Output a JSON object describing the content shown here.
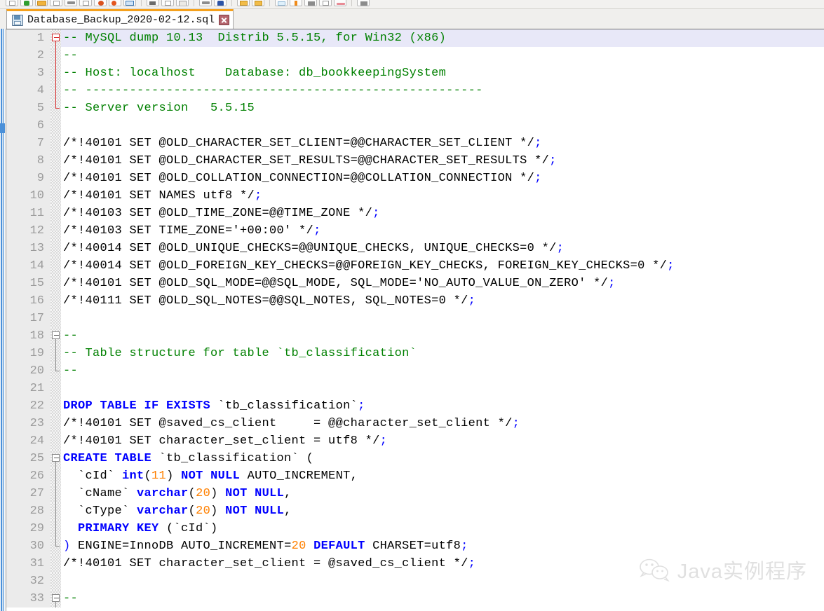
{
  "toolbar": {
    "icons": [
      "new-file-icon",
      "open-folder-icon",
      "save-icon",
      "save-all-icon",
      "close-icon",
      "close-all-icon",
      "print-icon",
      "cut-icon",
      "copy-icon",
      "paste-icon",
      "undo-icon",
      "redo-icon",
      "find-icon",
      "replace-icon",
      "zoom-in-icon",
      "zoom-out-icon",
      "sync-scroll-icon",
      "word-wrap-icon",
      "show-symbol-icon",
      "show-all-chars-icon",
      "indent-guide-icon",
      "macro-record-icon"
    ]
  },
  "tab": {
    "title": "Database_Backup_2020-02-12.sql",
    "file_icon": "floppy-disk-save-icon",
    "close_icon": "close-tab-icon",
    "accent_color": "#f5a11d"
  },
  "watermark": {
    "logo_icon": "wechat-icon",
    "text": "Java实例程序"
  },
  "colors": {
    "comment": "#008000",
    "keyword": "#0000ff",
    "number": "#ff8000",
    "operator": "#0000ff",
    "plain": "#000000",
    "current_line": "#e8e8f8",
    "gutter_bg": "#ebebeb",
    "gutter_fg": "#9b9b9b"
  },
  "editor": {
    "language": "SQL",
    "first_visible_line": 1,
    "last_visible_line": 33,
    "current_line": 1,
    "lines": [
      {
        "n": 1,
        "fold": "red-open",
        "hl": true,
        "tokens": [
          {
            "t": "-- MySQL dump 10.13  Distrib 5.5.15, for Win32 (x86)",
            "c": "c-com"
          }
        ]
      },
      {
        "n": 2,
        "fold": "red-line",
        "tokens": [
          {
            "t": "--",
            "c": "c-com"
          }
        ]
      },
      {
        "n": 3,
        "fold": "red-line",
        "tokens": [
          {
            "t": "-- Host: localhost    Database: db_bookkeepingSystem",
            "c": "c-com"
          }
        ]
      },
      {
        "n": 4,
        "fold": "red-line",
        "tokens": [
          {
            "t": "-- ------------------------------------------------------",
            "c": "c-com"
          }
        ]
      },
      {
        "n": 5,
        "fold": "red-end",
        "tokens": [
          {
            "t": "-- Server version   5.5.15",
            "c": "c-com"
          }
        ]
      },
      {
        "n": 6,
        "fold": "none",
        "tokens": []
      },
      {
        "n": 7,
        "fold": "none",
        "tokens": [
          {
            "t": "/*!40101 SET @OLD_CHARACTER_SET_CLIENT=@@CHARACTER_SET_CLIENT */",
            "c": "c-txt"
          },
          {
            "t": ";",
            "c": "c-op"
          }
        ]
      },
      {
        "n": 8,
        "fold": "none",
        "tokens": [
          {
            "t": "/*!40101 SET @OLD_CHARACTER_SET_RESULTS=@@CHARACTER_SET_RESULTS */",
            "c": "c-txt"
          },
          {
            "t": ";",
            "c": "c-op"
          }
        ]
      },
      {
        "n": 9,
        "fold": "none",
        "tokens": [
          {
            "t": "/*!40101 SET @OLD_COLLATION_CONNECTION=@@COLLATION_CONNECTION */",
            "c": "c-txt"
          },
          {
            "t": ";",
            "c": "c-op"
          }
        ]
      },
      {
        "n": 10,
        "fold": "none",
        "tokens": [
          {
            "t": "/*!40101 SET NAMES utf8 */",
            "c": "c-txt"
          },
          {
            "t": ";",
            "c": "c-op"
          }
        ]
      },
      {
        "n": 11,
        "fold": "none",
        "tokens": [
          {
            "t": "/*!40103 SET @OLD_TIME_ZONE=@@TIME_ZONE */",
            "c": "c-txt"
          },
          {
            "t": ";",
            "c": "c-op"
          }
        ]
      },
      {
        "n": 12,
        "fold": "none",
        "tokens": [
          {
            "t": "/*!40103 SET TIME_ZONE='+00:00' */",
            "c": "c-txt"
          },
          {
            "t": ";",
            "c": "c-op"
          }
        ]
      },
      {
        "n": 13,
        "fold": "none",
        "tokens": [
          {
            "t": "/*!40014 SET @OLD_UNIQUE_CHECKS=@@UNIQUE_CHECKS, UNIQUE_CHECKS=0 */",
            "c": "c-txt"
          },
          {
            "t": ";",
            "c": "c-op"
          }
        ]
      },
      {
        "n": 14,
        "fold": "none",
        "tokens": [
          {
            "t": "/*!40014 SET @OLD_FOREIGN_KEY_CHECKS=@@FOREIGN_KEY_CHECKS, FOREIGN_KEY_CHECKS=0 */",
            "c": "c-txt"
          },
          {
            "t": ";",
            "c": "c-op"
          }
        ]
      },
      {
        "n": 15,
        "fold": "none",
        "tokens": [
          {
            "t": "/*!40101 SET @OLD_SQL_MODE=@@SQL_MODE, SQL_MODE='NO_AUTO_VALUE_ON_ZERO' */",
            "c": "c-txt"
          },
          {
            "t": ";",
            "c": "c-op"
          }
        ]
      },
      {
        "n": 16,
        "fold": "none",
        "tokens": [
          {
            "t": "/*!40111 SET @OLD_SQL_NOTES=@@SQL_NOTES, SQL_NOTES=0 */",
            "c": "c-txt"
          },
          {
            "t": ";",
            "c": "c-op"
          }
        ]
      },
      {
        "n": 17,
        "fold": "none",
        "tokens": []
      },
      {
        "n": 18,
        "fold": "gray-open",
        "tokens": [
          {
            "t": "--",
            "c": "c-com"
          }
        ]
      },
      {
        "n": 19,
        "fold": "gray-line",
        "tokens": [
          {
            "t": "-- Table structure for table `tb_classification`",
            "c": "c-com"
          }
        ]
      },
      {
        "n": 20,
        "fold": "gray-end",
        "tokens": [
          {
            "t": "--",
            "c": "c-com"
          }
        ]
      },
      {
        "n": 21,
        "fold": "none",
        "tokens": []
      },
      {
        "n": 22,
        "fold": "none",
        "tokens": [
          {
            "t": "DROP TABLE IF EXISTS",
            "c": "c-kw"
          },
          {
            "t": " `tb_classification`",
            "c": "c-txt"
          },
          {
            "t": ";",
            "c": "c-op"
          }
        ]
      },
      {
        "n": 23,
        "fold": "none",
        "tokens": [
          {
            "t": "/*!40101 SET @saved_cs_client     = @@character_set_client */",
            "c": "c-txt"
          },
          {
            "t": ";",
            "c": "c-op"
          }
        ]
      },
      {
        "n": 24,
        "fold": "none",
        "tokens": [
          {
            "t": "/*!40101 SET character_set_client = utf8 */",
            "c": "c-txt"
          },
          {
            "t": ";",
            "c": "c-op"
          }
        ]
      },
      {
        "n": 25,
        "fold": "gray-open",
        "tokens": [
          {
            "t": "CREATE TABLE",
            "c": "c-kw"
          },
          {
            "t": " `tb_classification` (",
            "c": "c-txt"
          }
        ]
      },
      {
        "n": 26,
        "fold": "gray-line",
        "tokens": [
          {
            "t": "  `cId` ",
            "c": "c-txt"
          },
          {
            "t": "int",
            "c": "c-kw"
          },
          {
            "t": "(",
            "c": "c-txt"
          },
          {
            "t": "11",
            "c": "c-num"
          },
          {
            "t": ") ",
            "c": "c-txt"
          },
          {
            "t": "NOT NULL",
            "c": "c-kw"
          },
          {
            "t": " AUTO_INCREMENT,",
            "c": "c-txt"
          }
        ]
      },
      {
        "n": 27,
        "fold": "gray-line",
        "tokens": [
          {
            "t": "  `cName` ",
            "c": "c-txt"
          },
          {
            "t": "varchar",
            "c": "c-kw"
          },
          {
            "t": "(",
            "c": "c-txt"
          },
          {
            "t": "20",
            "c": "c-num"
          },
          {
            "t": ") ",
            "c": "c-txt"
          },
          {
            "t": "NOT NULL",
            "c": "c-kw"
          },
          {
            "t": ",",
            "c": "c-txt"
          }
        ]
      },
      {
        "n": 28,
        "fold": "gray-line",
        "tokens": [
          {
            "t": "  `cType` ",
            "c": "c-txt"
          },
          {
            "t": "varchar",
            "c": "c-kw"
          },
          {
            "t": "(",
            "c": "c-txt"
          },
          {
            "t": "20",
            "c": "c-num"
          },
          {
            "t": ") ",
            "c": "c-txt"
          },
          {
            "t": "NOT NULL",
            "c": "c-kw"
          },
          {
            "t": ",",
            "c": "c-txt"
          }
        ]
      },
      {
        "n": 29,
        "fold": "gray-line",
        "tokens": [
          {
            "t": "  ",
            "c": "c-txt"
          },
          {
            "t": "PRIMARY KEY",
            "c": "c-kw"
          },
          {
            "t": " (`cId`)",
            "c": "c-txt"
          }
        ]
      },
      {
        "n": 30,
        "fold": "gray-end",
        "tokens": [
          {
            "t": ")",
            "c": "c-op"
          },
          {
            "t": " ENGINE=InnoDB AUTO_INCREMENT=",
            "c": "c-txt"
          },
          {
            "t": "20",
            "c": "c-num"
          },
          {
            "t": " ",
            "c": "c-txt"
          },
          {
            "t": "DEFAULT",
            "c": "c-kw"
          },
          {
            "t": " CHARSET=utf8",
            "c": "c-txt"
          },
          {
            "t": ";",
            "c": "c-op"
          }
        ]
      },
      {
        "n": 31,
        "fold": "none",
        "tokens": [
          {
            "t": "/*!40101 SET character_set_client = @saved_cs_client */",
            "c": "c-txt"
          },
          {
            "t": ";",
            "c": "c-op"
          }
        ]
      },
      {
        "n": 32,
        "fold": "none",
        "tokens": []
      },
      {
        "n": 33,
        "fold": "gray-open",
        "tokens": [
          {
            "t": "--",
            "c": "c-com"
          }
        ]
      }
    ]
  }
}
